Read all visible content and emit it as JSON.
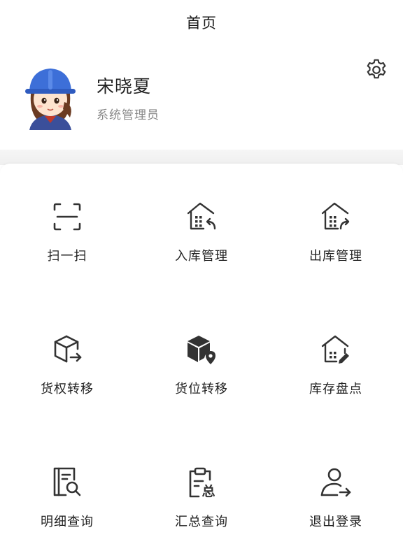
{
  "header": {
    "title": "首页"
  },
  "profile": {
    "name": "宋晓夏",
    "role": "系统管理员"
  },
  "icons": {
    "settings": "gear-icon",
    "scan": "scan-icon",
    "inbound": "warehouse-inbound-icon",
    "outbound": "warehouse-outbound-icon",
    "ownership": "box-transfer-icon",
    "location": "box-location-icon",
    "inventory": "warehouse-edit-icon",
    "detail": "document-search-icon",
    "summary": "clipboard-summary-icon",
    "logout": "user-logout-icon"
  },
  "menu": [
    {
      "label": "扫一扫"
    },
    {
      "label": "入库管理"
    },
    {
      "label": "出库管理"
    },
    {
      "label": "货权转移"
    },
    {
      "label": "货位转移"
    },
    {
      "label": "库存盘点"
    },
    {
      "label": "明细查询"
    },
    {
      "label": "汇总查询"
    },
    {
      "label": "退出登录"
    }
  ],
  "colors": {
    "text": "#222222",
    "muted": "#888888",
    "avatar_helmet": "#3d6fd8"
  }
}
